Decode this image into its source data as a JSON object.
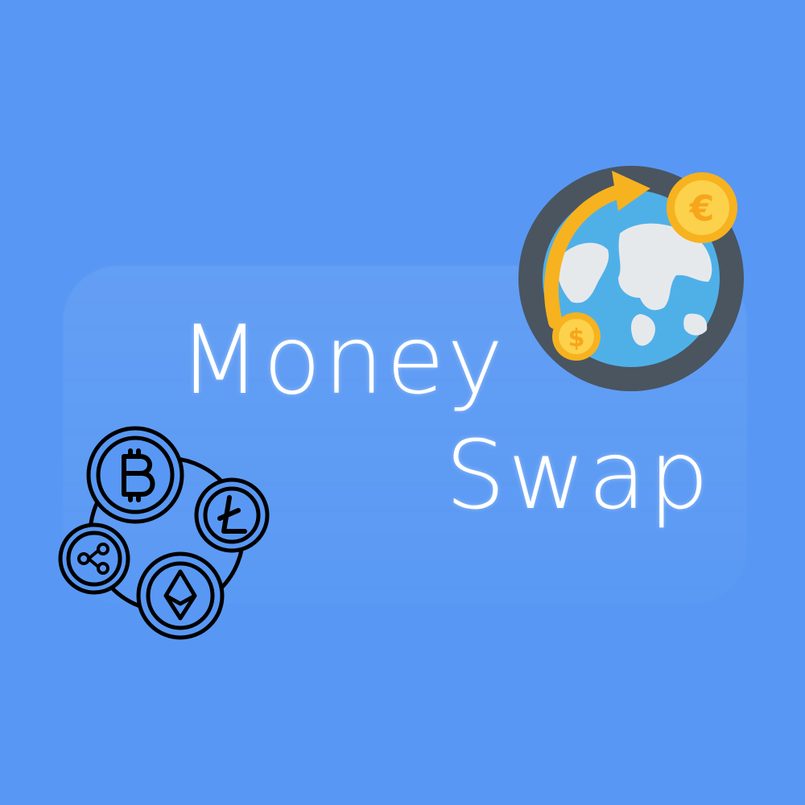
{
  "logo": {
    "line1": "Money",
    "line2": "Swap"
  },
  "icons": {
    "globe": "globe-currency-exchange-icon",
    "crypto": "crypto-coins-network-icon",
    "dollar_coin_symbol": "$",
    "euro_coin_symbol": "€"
  },
  "colors": {
    "background": "#5898f4",
    "text": "#ffffff",
    "globe_ring": "#4a5560",
    "globe_ocean": "#4fb0e8",
    "globe_land": "#e6e9ec",
    "coin": "#f7b21f",
    "coin_face": "#fcd14b"
  }
}
